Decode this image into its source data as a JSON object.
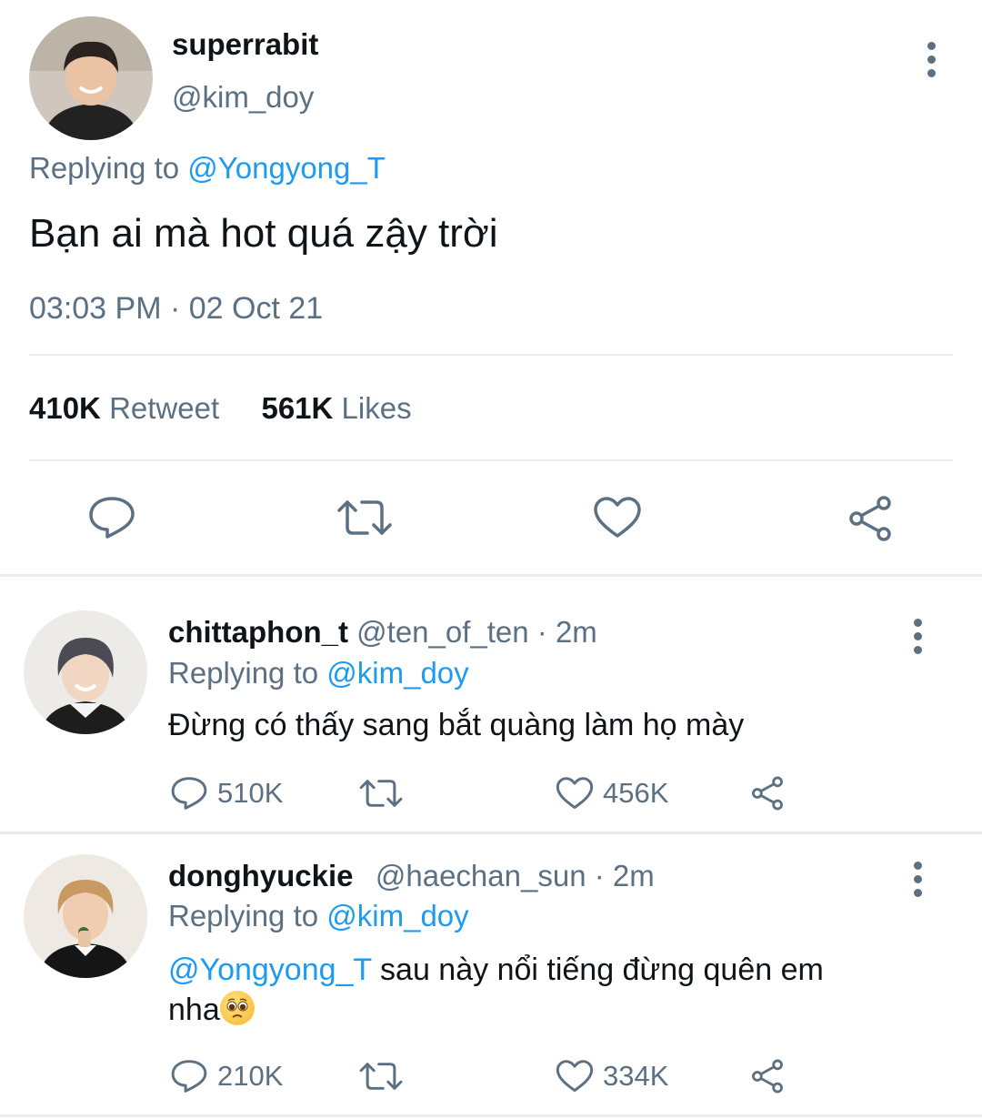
{
  "main_tweet": {
    "display_name": "superrabit",
    "handle": "@kim_doy",
    "replying_label": "Replying to",
    "replying_to": "@Yongyong_T",
    "text": "Bạn ai mà hot quá zậy trời",
    "timestamp": "03:03 PM · 02 Oct 21",
    "retweet_count": "410K",
    "retweet_label": "Retweet",
    "like_count": "561K",
    "like_label": "Likes"
  },
  "replies": [
    {
      "display_name": "chittaphon_t",
      "handle_time": "@ten_of_ten · 2m",
      "replying_label": "Replying to",
      "replying_to": "@kim_doy",
      "text": "Đừng có thấy sang bắt quàng làm họ mày",
      "reply_count": "510K",
      "like_count": "456K"
    },
    {
      "display_name": "donghyuckie",
      "handle_time": "@haechan_sun · 2m",
      "replying_label": "Replying to",
      "replying_to": "@kim_doy",
      "mention": "@Yongyong_T",
      "text_line1": " sau này nổi tiếng đừng quên em",
      "text_line2": "nha",
      "reply_count": "210K",
      "like_count": "334K"
    }
  ],
  "icons": [
    "reply-icon",
    "retweet-icon",
    "like-icon",
    "share-icon",
    "more-icon",
    "pleading-face-emoji"
  ],
  "colors": {
    "accent": "#1d9bf0",
    "secondary_text": "#5b7083",
    "divider": "#e6ecf0"
  }
}
